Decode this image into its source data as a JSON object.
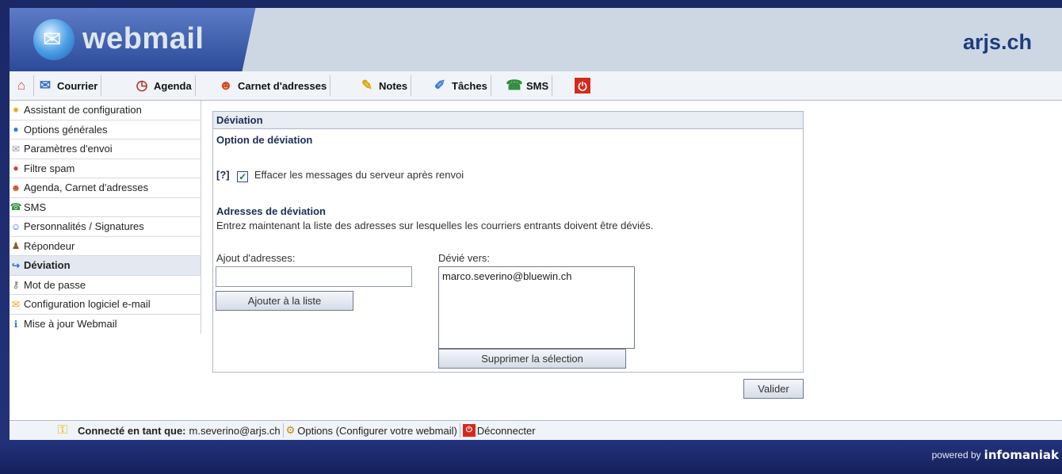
{
  "header": {
    "app_name": "webmail",
    "domain": "arjs.ch"
  },
  "nav": {
    "items": [
      {
        "label": "Courrier",
        "icon": "mail-icon"
      },
      {
        "label": "Agenda",
        "icon": "calendar-icon"
      },
      {
        "label": "Carnet d'adresses",
        "icon": "contacts-icon"
      },
      {
        "label": "Notes",
        "icon": "notes-icon"
      },
      {
        "label": "Tâches",
        "icon": "tasks-icon"
      },
      {
        "label": "SMS",
        "icon": "sms-icon"
      }
    ]
  },
  "sidebar": {
    "items": [
      {
        "label": "Assistant de configuration",
        "icon": "wizard-icon"
      },
      {
        "label": "Options générales",
        "icon": "options-icon"
      },
      {
        "label": "Paramètres d'envoi",
        "icon": "send-icon"
      },
      {
        "label": "Filtre spam",
        "icon": "spam-filter-icon"
      },
      {
        "label": "Agenda, Carnet d'adresses",
        "icon": "contacts-icon"
      },
      {
        "label": "SMS",
        "icon": "sms-icon"
      },
      {
        "label": "Personnalités / Signatures",
        "icon": "signature-icon"
      },
      {
        "label": "Répondeur",
        "icon": "responder-icon"
      },
      {
        "label": "Déviation",
        "icon": "redirect-icon",
        "active": true
      },
      {
        "label": "Mot de passe",
        "icon": "key-icon"
      },
      {
        "label": "Configuration logiciel e-mail",
        "icon": "mail-client-icon"
      },
      {
        "label": "Mise à jour Webmail",
        "icon": "info-icon"
      }
    ]
  },
  "panel": {
    "title": "Déviation",
    "option_heading": "Option de déviation",
    "help": "[?]",
    "checkbox_label": "Effacer les messages du serveur après renvoi",
    "checkbox_checked": true,
    "addresses_heading": "Adresses de déviation",
    "addresses_desc": "Entrez maintenant la liste des adresses sur lesquelles les courriers entrants doivent être déviés.",
    "add_label": "Ajout d'adresses:",
    "add_value": "",
    "add_button": "Ajouter à la liste",
    "list_label": "Dévié vers:",
    "list_items": [
      "marco.severino@bluewin.ch"
    ],
    "remove_button": "Supprimer la sélection",
    "submit_button": "Valider"
  },
  "status": {
    "connected_label": "Connecté en tant que:",
    "user": "m.severino@arjs.ch",
    "options_label": "Options (Configurer votre webmail)",
    "logout_label": "Déconnecter"
  },
  "footer": {
    "powered_by": "powered by",
    "brand": "infomaniak"
  },
  "colors": {
    "frame": "#1b2a66",
    "header_bg": "#cdd7e4",
    "accent": "#2b4a98",
    "logout_red": "#d8281d"
  }
}
